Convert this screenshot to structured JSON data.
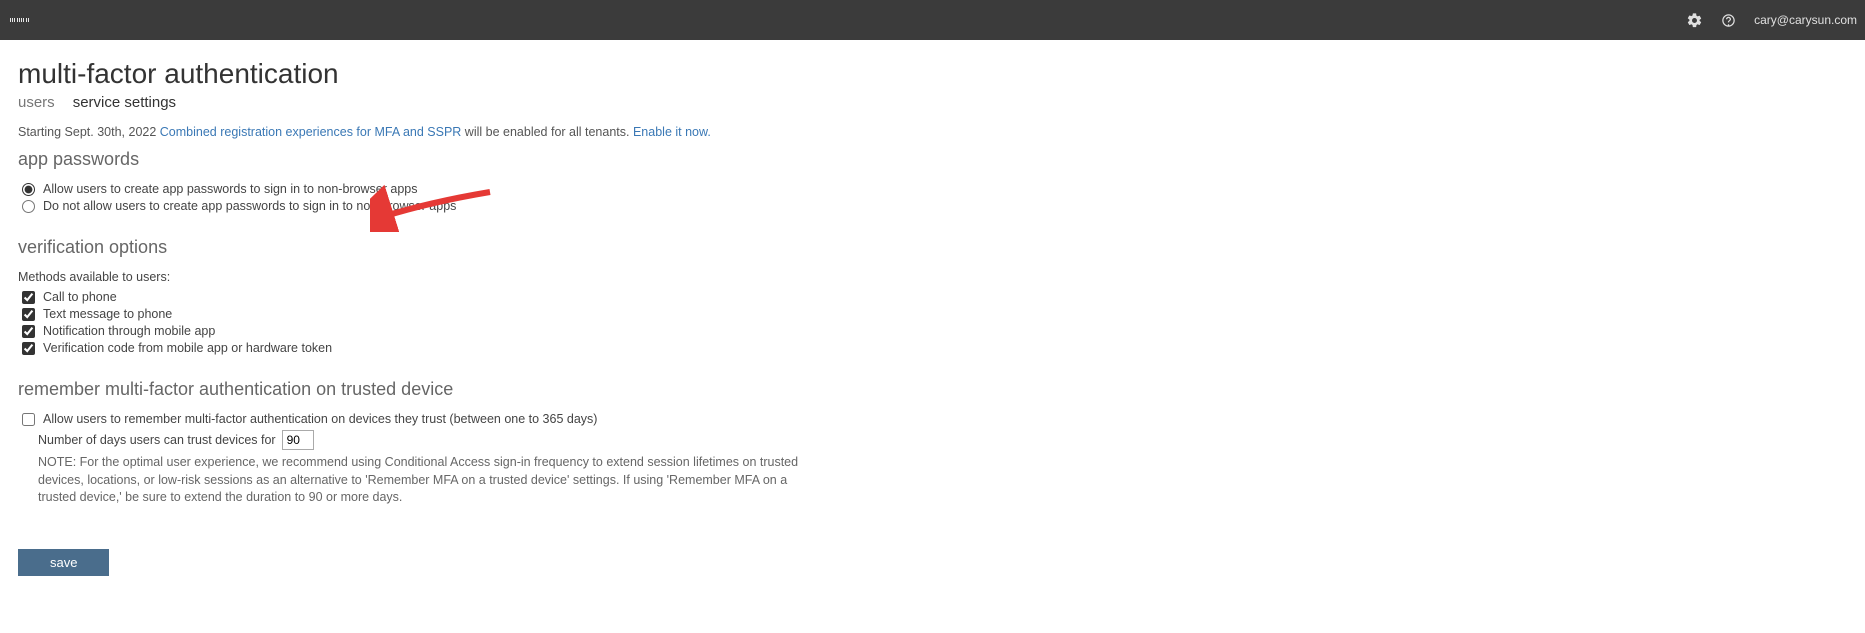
{
  "header": {
    "user_email": "cary@carysun.com"
  },
  "page": {
    "title": "multi-factor authentication",
    "tabs": {
      "users": "users",
      "service_settings": "service settings"
    },
    "banner": {
      "prefix": "Starting Sept. 30th, 2022 ",
      "link1": "Combined registration experiences for MFA and SSPR",
      "mid": " will be enabled for all tenants. ",
      "link2": "Enable it now.",
      "suffix": ""
    }
  },
  "app_passwords": {
    "heading": "app passwords",
    "opt_allow": "Allow users to create app passwords to sign in to non-browser apps",
    "opt_deny": "Do not allow users to create app passwords to sign in to non-browser apps"
  },
  "verification": {
    "heading": "verification options",
    "sub": "Methods available to users:",
    "opt_call": "Call to phone",
    "opt_text": "Text message to phone",
    "opt_notify": "Notification through mobile app",
    "opt_code": "Verification code from mobile app or hardware token"
  },
  "remember": {
    "heading": "remember multi-factor authentication on trusted device",
    "check_label": "Allow users to remember multi-factor authentication on devices they trust (between one to 365 days)",
    "days_label": "Number of days users can trust devices for",
    "days_value": "90",
    "note": "NOTE: For the optimal user experience, we recommend using Conditional Access sign-in frequency to extend session lifetimes on trusted devices, locations, or low-risk sessions as an alternative to 'Remember MFA on a trusted device' settings. If using 'Remember MFA on a trusted device,' be sure to extend the duration to 90 or more days."
  },
  "footer": {
    "save": "save"
  }
}
